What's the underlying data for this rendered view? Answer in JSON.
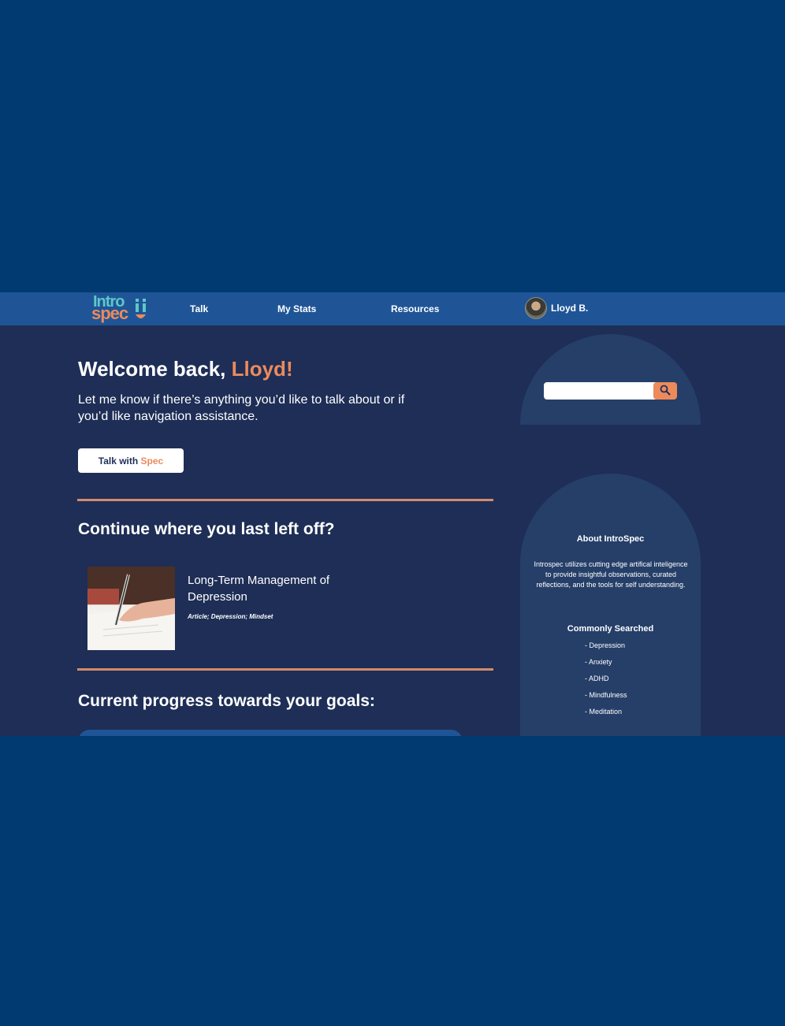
{
  "brand": {
    "line1": "Intro",
    "line2": "spec"
  },
  "nav": {
    "items": [
      {
        "label": "Talk"
      },
      {
        "label": "My Stats"
      },
      {
        "label": "Resources"
      }
    ],
    "user": {
      "name": "Lloyd B."
    }
  },
  "welcome": {
    "greeting": "Welcome back, ",
    "name": "Lloyd!",
    "subtitle": "Let me know if there’s anything you’d like to talk about or if you’d like navigation assistance."
  },
  "talk_button": {
    "prefix": "Talk with ",
    "accent": "Spec"
  },
  "continue": {
    "heading": "Continue where you last left off?",
    "article": {
      "title": "Long-Term Management of Depression",
      "tags": "Article; Depression; Mindset"
    }
  },
  "progress": {
    "heading": "Current progress towards your goals:"
  },
  "search": {
    "placeholder": ""
  },
  "about": {
    "title": "About IntroSpec",
    "text": "Introspec utilizes cutting edge artifical inteligence to provide insightful observations, curated reflections, and the tools for self understanding."
  },
  "common": {
    "title": "Commonly Searched",
    "items": [
      "- Depression",
      "- Anxiety",
      "- ADHD",
      "- Mindfulness",
      "- Meditation"
    ]
  },
  "colors": {
    "page_bg": "#003a70",
    "nav_bg": "#1f5597",
    "main_bg": "#1e2e56",
    "panel_bg": "#263f69",
    "accent": "#ec8a5c",
    "teal": "#5ec7c9"
  },
  "icons": {
    "search": "magnifier-icon",
    "brand": "introspec-logo"
  }
}
